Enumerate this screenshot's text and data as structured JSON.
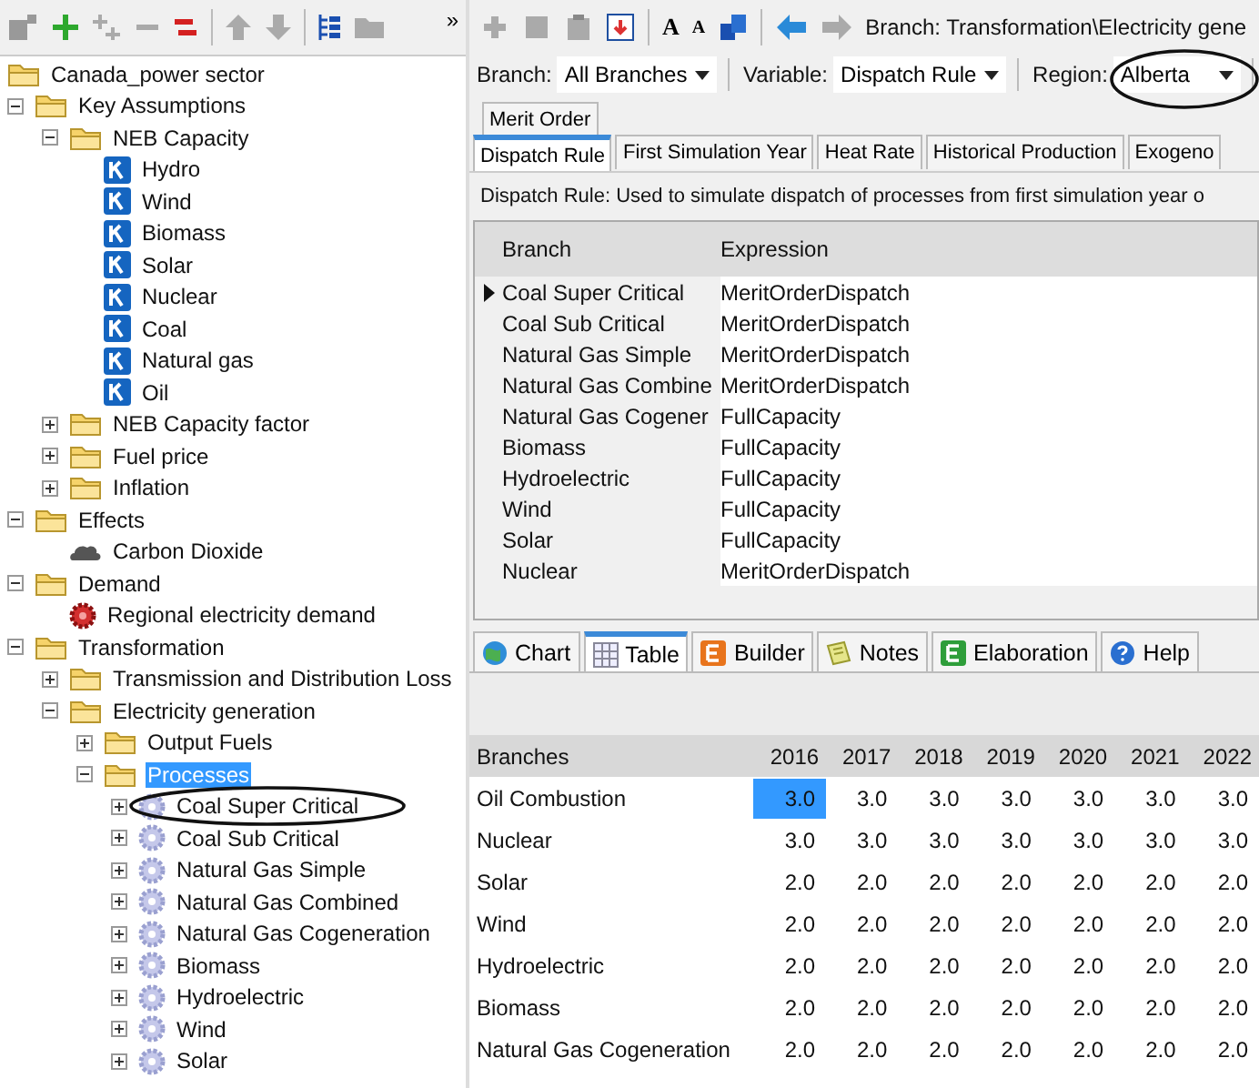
{
  "left_toolbar": {
    "more": "»"
  },
  "tree": [
    {
      "label": "Canada_power sector",
      "kind": "folder",
      "selected": false,
      "children": [
        {
          "label": "Key Assumptions",
          "kind": "folder",
          "expanded": true,
          "selected": false,
          "children": [
            {
              "label": "NEB Capacity",
              "kind": "folder",
              "expanded": true,
              "selected": false,
              "children": [
                {
                  "label": "Hydro",
                  "kind": "key",
                  "selected": false
                },
                {
                  "label": "Wind",
                  "kind": "key",
                  "selected": false
                },
                {
                  "label": "Biomass",
                  "kind": "key",
                  "selected": false
                },
                {
                  "label": "Solar",
                  "kind": "key",
                  "selected": false
                },
                {
                  "label": "Nuclear",
                  "kind": "key",
                  "selected": false
                },
                {
                  "label": "Coal",
                  "kind": "key",
                  "selected": false
                },
                {
                  "label": "Natural gas",
                  "kind": "key",
                  "selected": false
                },
                {
                  "label": "Oil",
                  "kind": "key",
                  "selected": false
                }
              ]
            },
            {
              "label": "NEB Capacity factor",
              "kind": "folder",
              "expanded": false,
              "selected": false
            },
            {
              "label": "Fuel price",
              "kind": "folder",
              "expanded": false,
              "selected": false
            },
            {
              "label": "Inflation",
              "kind": "folder",
              "expanded": false,
              "selected": false
            }
          ]
        },
        {
          "label": "Effects",
          "kind": "folder",
          "expanded": true,
          "selected": false,
          "children": [
            {
              "label": "Carbon Dioxide",
              "kind": "cloud",
              "selected": false
            }
          ]
        },
        {
          "label": "Demand",
          "kind": "folder",
          "expanded": true,
          "selected": false,
          "children": [
            {
              "label": "Regional electricity demand",
              "kind": "demand",
              "selected": false
            }
          ]
        },
        {
          "label": "Transformation",
          "kind": "folder",
          "expanded": true,
          "selected": false,
          "children": [
            {
              "label": "Transmission and Distribution Loss",
              "kind": "folder",
              "expanded": false,
              "selected": false
            },
            {
              "label": "Electricity generation",
              "kind": "folder",
              "expanded": true,
              "selected": false,
              "children": [
                {
                  "label": "Output Fuels",
                  "kind": "folder",
                  "expanded": false,
                  "selected": false
                },
                {
                  "label": "Processes",
                  "kind": "folder",
                  "expanded": true,
                  "selected": true,
                  "children": [
                    {
                      "label": "Coal Super Critical",
                      "kind": "process",
                      "expanded": false,
                      "selected": false
                    },
                    {
                      "label": "Coal Sub Critical",
                      "kind": "process",
                      "expanded": false,
                      "selected": false
                    },
                    {
                      "label": "Natural Gas Simple",
                      "kind": "process",
                      "expanded": false,
                      "selected": false
                    },
                    {
                      "label": "Natural Gas Combined",
                      "kind": "process",
                      "expanded": false,
                      "selected": false
                    },
                    {
                      "label": "Natural Gas Cogeneration",
                      "kind": "process",
                      "expanded": false,
                      "selected": false
                    },
                    {
                      "label": "Biomass",
                      "kind": "process",
                      "expanded": false,
                      "selected": false
                    },
                    {
                      "label": "Hydroelectric",
                      "kind": "process",
                      "expanded": false,
                      "selected": false
                    },
                    {
                      "label": "Wind",
                      "kind": "process",
                      "expanded": false,
                      "selected": false
                    },
                    {
                      "label": "Solar",
                      "kind": "process",
                      "expanded": false,
                      "selected": false
                    }
                  ]
                }
              ]
            }
          ]
        }
      ]
    }
  ],
  "right_toolbar": {
    "font_larger": "A",
    "font_smaller": "A",
    "breadcrumb": "Branch: Transformation\\Electricity gene"
  },
  "filters": [
    {
      "label": "Branch:",
      "value": "All Branches"
    },
    {
      "label": "Variable:",
      "value": "Dispatch Rule"
    },
    {
      "label": "Region:",
      "value": "Alberta"
    }
  ],
  "variable_tabs_row2": [
    {
      "label": "Merit Order",
      "selected": false
    }
  ],
  "variable_tabs": [
    {
      "label": "Dispatch Rule",
      "selected": true
    },
    {
      "label": "First Simulation Year",
      "selected": false
    },
    {
      "label": "Heat Rate",
      "selected": false
    },
    {
      "label": "Historical Production",
      "selected": false
    },
    {
      "label": "Exogeno",
      "selected": false
    }
  ],
  "description": "Dispatch Rule: Used to simulate dispatch of processes from first simulation year o",
  "expression_table": {
    "columns": [
      "Branch",
      "Expression"
    ],
    "rows": [
      {
        "branch": "Coal Super Critical",
        "expression": "MeritOrderDispatch",
        "current": true
      },
      {
        "branch": "Coal Sub Critical",
        "expression": "MeritOrderDispatch",
        "current": false
      },
      {
        "branch": "Natural Gas Simple",
        "expression": "MeritOrderDispatch",
        "current": false
      },
      {
        "branch": "Natural Gas Combine",
        "expression": "MeritOrderDispatch",
        "current": false
      },
      {
        "branch": "Natural Gas Cogener",
        "expression": "FullCapacity",
        "current": false
      },
      {
        "branch": "Biomass",
        "expression": "FullCapacity",
        "current": false
      },
      {
        "branch": "Hydroelectric",
        "expression": "FullCapacity",
        "current": false
      },
      {
        "branch": "Wind",
        "expression": "FullCapacity",
        "current": false
      },
      {
        "branch": "Solar",
        "expression": "FullCapacity",
        "current": false
      },
      {
        "branch": "Nuclear",
        "expression": "MeritOrderDispatch",
        "current": false
      }
    ]
  },
  "result_tabs": [
    {
      "label": "Chart",
      "kind": "chart",
      "selected": false
    },
    {
      "label": "Table",
      "kind": "table",
      "selected": true
    },
    {
      "label": "Builder",
      "kind": "builder",
      "selected": false
    },
    {
      "label": "Notes",
      "kind": "notes",
      "selected": false
    },
    {
      "label": "Elaboration",
      "kind": "elaboration",
      "selected": false
    },
    {
      "label": "Help",
      "kind": "help",
      "selected": false
    }
  ],
  "result_table": {
    "row_header": "Branches",
    "years": [
      "2016",
      "2017",
      "2018",
      "2019",
      "2020",
      "2021",
      "2022"
    ],
    "rows": [
      {
        "branch": "Oil Combustion",
        "cells": [
          {
            "text": "3.0",
            "selected": true
          },
          {
            "text": "3.0",
            "selected": false
          },
          {
            "text": "3.0",
            "selected": false
          },
          {
            "text": "3.0",
            "selected": false
          },
          {
            "text": "3.0",
            "selected": false
          },
          {
            "text": "3.0",
            "selected": false
          },
          {
            "text": "3.0",
            "selected": false
          }
        ]
      },
      {
        "branch": "Nuclear",
        "cells": [
          {
            "text": "3.0",
            "selected": false
          },
          {
            "text": "3.0",
            "selected": false
          },
          {
            "text": "3.0",
            "selected": false
          },
          {
            "text": "3.0",
            "selected": false
          },
          {
            "text": "3.0",
            "selected": false
          },
          {
            "text": "3.0",
            "selected": false
          },
          {
            "text": "3.0",
            "selected": false
          }
        ]
      },
      {
        "branch": "Solar",
        "cells": [
          {
            "text": "2.0",
            "selected": false
          },
          {
            "text": "2.0",
            "selected": false
          },
          {
            "text": "2.0",
            "selected": false
          },
          {
            "text": "2.0",
            "selected": false
          },
          {
            "text": "2.0",
            "selected": false
          },
          {
            "text": "2.0",
            "selected": false
          },
          {
            "text": "2.0",
            "selected": false
          }
        ]
      },
      {
        "branch": "Wind",
        "cells": [
          {
            "text": "2.0",
            "selected": false
          },
          {
            "text": "2.0",
            "selected": false
          },
          {
            "text": "2.0",
            "selected": false
          },
          {
            "text": "2.0",
            "selected": false
          },
          {
            "text": "2.0",
            "selected": false
          },
          {
            "text": "2.0",
            "selected": false
          },
          {
            "text": "2.0",
            "selected": false
          }
        ]
      },
      {
        "branch": "Hydroelectric",
        "cells": [
          {
            "text": "2.0",
            "selected": false
          },
          {
            "text": "2.0",
            "selected": false
          },
          {
            "text": "2.0",
            "selected": false
          },
          {
            "text": "2.0",
            "selected": false
          },
          {
            "text": "2.0",
            "selected": false
          },
          {
            "text": "2.0",
            "selected": false
          },
          {
            "text": "2.0",
            "selected": false
          }
        ]
      },
      {
        "branch": "Biomass",
        "cells": [
          {
            "text": "2.0",
            "selected": false
          },
          {
            "text": "2.0",
            "selected": false
          },
          {
            "text": "2.0",
            "selected": false
          },
          {
            "text": "2.0",
            "selected": false
          },
          {
            "text": "2.0",
            "selected": false
          },
          {
            "text": "2.0",
            "selected": false
          },
          {
            "text": "2.0",
            "selected": false
          }
        ]
      },
      {
        "branch": "Natural Gas Cogeneration",
        "cells": [
          {
            "text": "2.0",
            "selected": false
          },
          {
            "text": "2.0",
            "selected": false
          },
          {
            "text": "2.0",
            "selected": false
          },
          {
            "text": "2.0",
            "selected": false
          },
          {
            "text": "2.0",
            "selected": false
          },
          {
            "text": "2.0",
            "selected": false
          },
          {
            "text": "2.0",
            "selected": false
          }
        ]
      }
    ]
  }
}
